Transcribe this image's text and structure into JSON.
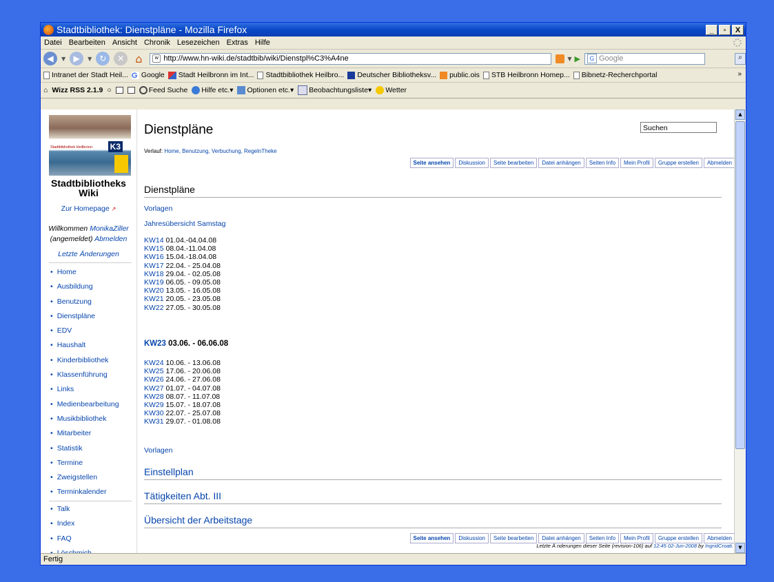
{
  "window": {
    "title": "Stadtbibliothek: Dienstpläne - Mozilla Firefox",
    "min": "_",
    "max": "▫",
    "close": "X"
  },
  "menu": [
    "Datei",
    "Bearbeiten",
    "Ansicht",
    "Chronik",
    "Lesezeichen",
    "Extras",
    "Hilfe"
  ],
  "nav": {
    "url": "http://www.hn-wiki.de/stadtbib/wiki/Dienstpl%C3%A4ne",
    "search_placeholder": "Google"
  },
  "bookmarks": [
    "Intranet der Stadt Heil...",
    "Google",
    "Stadt Heilbronn im Int...",
    "Stadtbibliothek Heilbro...",
    "Deutscher Bibliotheksv...",
    "public.ois",
    "STB Heilbronn Homep...",
    "Bibnetz-Recherchportal"
  ],
  "wizz": {
    "label": "Wizz RSS 2.1.9",
    "items": [
      "Feed Suche",
      "Hilfe etc.",
      "Optionen etc.",
      "Beobachtungsliste",
      "Wetter"
    ]
  },
  "sidebar": {
    "logo_text": "Stadtbibliothek Heilbronn",
    "logo_k3": "K3",
    "wiki_title": "Stadtbibliotheks Wiki",
    "homepage": "Zur Homepage",
    "welcome_prefix": "Willkommen",
    "user": "MonikaZiller",
    "logged_in": "(angemeldet)",
    "logout": "Abmelden",
    "recent": "Letzte Änderungen",
    "nav": [
      "Home",
      "Ausbildung",
      "Benutzung",
      "Dienstpläne",
      "EDV",
      "Haushalt",
      "Kinderbibliothek",
      "Klassenführung",
      "Links",
      "Medienbearbeitung",
      "Musikbibliothek",
      "Mitarbeiter",
      "Statistik",
      "Termine",
      "Zweigstellen",
      "Terminkalender"
    ],
    "nav2": [
      "Talk",
      "Index",
      "FAQ",
      "Löschmich"
    ]
  },
  "main": {
    "title": "Dienstpläne",
    "search": "Suchen",
    "history_label": "Verlauf:",
    "history_links": "Home, Benutzung, Verbuchung, RegelnTheke",
    "tabs": [
      "Seite ansehen",
      "Diskussion",
      "Seite bearbeiten",
      "Datei anhängen",
      "Seiten Info",
      "Mein Profil",
      "Gruppe erstellen",
      "Abmelden"
    ],
    "section_title": "Dienstpläne",
    "vorlagen": "Vorlagen",
    "jahres": "Jahresübersicht Samstag",
    "weeks1": [
      {
        "kw": "KW14",
        "range": "01.04.-04.04.08"
      },
      {
        "kw": "KW15",
        "range": "08.04.-11.04.08"
      },
      {
        "kw": "KW16",
        "range": "15.04.-18.04.08"
      },
      {
        "kw": "KW17",
        "range": "22.04. - 25.04.08"
      },
      {
        "kw": "KW18",
        "range": "29.04. - 02.05.08"
      },
      {
        "kw": "KW19",
        "range": "06.05. - 09.05.08"
      },
      {
        "kw": "KW20",
        "range": "13.05. - 16.05.08"
      },
      {
        "kw": "KW21",
        "range": "20.05. - 23.05.08"
      },
      {
        "kw": "KW22",
        "range": "27.05. - 30.05.08"
      }
    ],
    "highlight": {
      "kw": "KW23",
      "range": "03.06. - 06.06.08"
    },
    "weeks2": [
      {
        "kw": "KW24",
        "range": "10.06. - 13.06.08"
      },
      {
        "kw": "KW25",
        "range": "17.06. - 20.06.08"
      },
      {
        "kw": "KW26",
        "range": "24.06. - 27.06.08"
      },
      {
        "kw": "KW27",
        "range": "01.07. - 04.07.08"
      },
      {
        "kw": "KW28",
        "range": "08.07. - 11.07.08"
      },
      {
        "kw": "KW29",
        "range": "15.07. - 18.07.08"
      },
      {
        "kw": "KW30",
        "range": "22.07. - 25.07.08"
      },
      {
        "kw": "KW31",
        "range": "29.07. - 01.08.08"
      }
    ],
    "sections": [
      "Einstellplan",
      "Tätigkeiten Abt. III",
      "Übersicht der Arbeitstage"
    ],
    "footer_prefix": "Letzte Ä nderungen dieser Seite (revision-106) auf",
    "footer_date": "12:45 02-Jun-2008",
    "footer_by": "by",
    "footer_user": "IngridCroati."
  },
  "status": "Fertig"
}
